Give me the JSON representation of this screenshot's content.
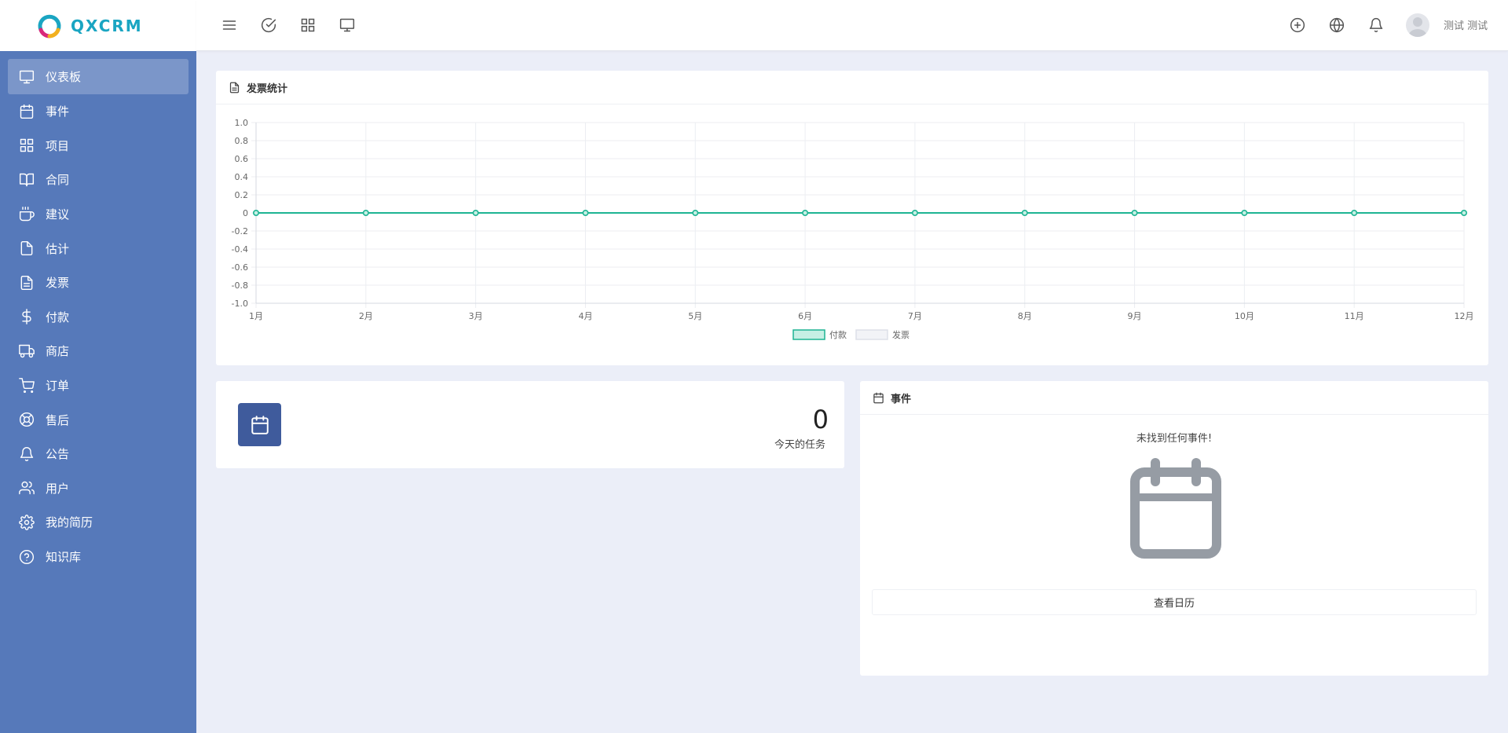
{
  "brand": {
    "name": "QXCRM"
  },
  "sidebar": {
    "items": [
      {
        "label": "仪表板",
        "icon": "monitor-icon",
        "active": true
      },
      {
        "label": "事件",
        "icon": "calendar-icon"
      },
      {
        "label": "项目",
        "icon": "grid-icon"
      },
      {
        "label": "合同",
        "icon": "book-icon"
      },
      {
        "label": "建议",
        "icon": "coffee-icon"
      },
      {
        "label": "估计",
        "icon": "file-icon"
      },
      {
        "label": "发票",
        "icon": "file-text-icon"
      },
      {
        "label": "付款",
        "icon": "dollar-icon"
      },
      {
        "label": "商店",
        "icon": "truck-icon"
      },
      {
        "label": "订单",
        "icon": "cart-icon"
      },
      {
        "label": "售后",
        "icon": "lifebuoy-icon"
      },
      {
        "label": "公告",
        "icon": "bell-icon"
      },
      {
        "label": "用户",
        "icon": "users-icon"
      },
      {
        "label": "我的简历",
        "icon": "gear-icon"
      },
      {
        "label": "知识库",
        "icon": "help-circle-icon"
      }
    ]
  },
  "topbar": {
    "user_name": "测试 测试"
  },
  "invoice_card": {
    "title": "发票统计"
  },
  "chart_data": {
    "type": "line",
    "title": "",
    "categories": [
      "1月",
      "2月",
      "3月",
      "4月",
      "5月",
      "6月",
      "7月",
      "8月",
      "9月",
      "10月",
      "11月",
      "12月"
    ],
    "series": [
      {
        "name": "付款",
        "values": [
          0,
          0,
          0,
          0,
          0,
          0,
          0,
          0,
          0,
          0,
          0,
          0
        ],
        "color": "#1eb493"
      },
      {
        "name": "发票",
        "values": [
          0,
          0,
          0,
          0,
          0,
          0,
          0,
          0,
          0,
          0,
          0,
          0
        ],
        "color": "#dde0e8"
      }
    ],
    "ylim": [
      -1.0,
      1.0
    ],
    "yticks": [
      "1.0",
      "0.8",
      "0.6",
      "0.4",
      "0.2",
      "0",
      "-0.2",
      "-0.4",
      "-0.6",
      "-0.8",
      "-1.0"
    ],
    "grid": true,
    "legend": "bottom-center"
  },
  "task_card": {
    "count": "0",
    "label": "今天的任务"
  },
  "events_card": {
    "title": "事件",
    "empty_message": "未找到任何事件!",
    "view_calendar": "查看日历"
  },
  "colors": {
    "sidebar": "#5679ba",
    "accent": "#1aa5c2",
    "background": "#ebeef8",
    "task_icon_bg": "#3f5b9c"
  }
}
